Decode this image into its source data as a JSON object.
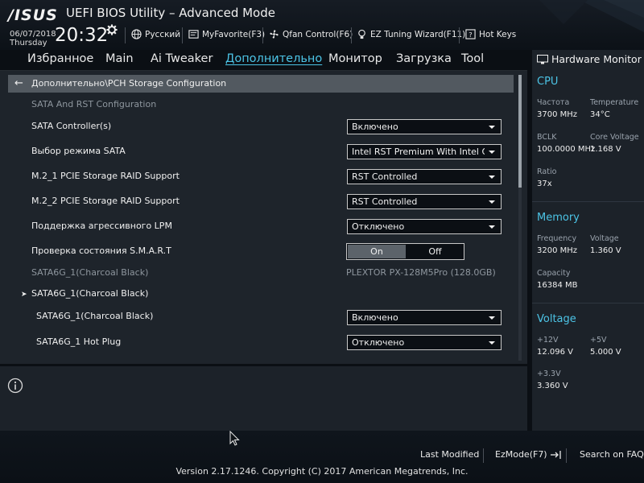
{
  "header": {
    "logo": "/ISUS",
    "title": "UEFI BIOS Utility – Advanced Mode",
    "date": "06/07/2018",
    "day": "Thursday",
    "time": "20:32",
    "buttons": [
      {
        "label": "Русский",
        "icon": "globe-icon"
      },
      {
        "label": "MyFavorite(F3)",
        "icon": "favorite-icon"
      },
      {
        "label": "Qfan Control(F6)",
        "icon": "fan-icon"
      },
      {
        "label": "EZ Tuning Wizard(F11)",
        "icon": "bulb-icon"
      },
      {
        "label": "Hot Keys",
        "icon": "hotkeys-icon"
      }
    ]
  },
  "tabs": [
    {
      "label": "Избранное",
      "active": false
    },
    {
      "label": "Main",
      "active": false
    },
    {
      "label": "Ai Tweaker",
      "active": false
    },
    {
      "label": "Дополнительно",
      "active": true
    },
    {
      "label": "Монитор",
      "active": false
    },
    {
      "label": "Загрузка",
      "active": false
    },
    {
      "label": "Tool",
      "active": false
    }
  ],
  "breadcrumb": "Дополнительно\\PCH Storage Configuration",
  "section_header": "SATA And RST Configuration",
  "rows": [
    {
      "label": "SATA Controller(s)",
      "type": "select",
      "value": "Включено"
    },
    {
      "label": "Выбор режима SATA",
      "type": "select",
      "value": "Intel RST Premium With Intel Optane"
    },
    {
      "label": "M.2_1 PCIE Storage RAID Support",
      "type": "select",
      "value": "RST Controlled"
    },
    {
      "label": "M.2_2 PCIE Storage RAID Support",
      "type": "select",
      "value": "RST Controlled"
    },
    {
      "label": "Поддержка агрессивного LPM",
      "type": "select",
      "value": "Отключено"
    },
    {
      "label": "Проверка состояния S.M.A.R.T",
      "type": "toggle",
      "on": "On",
      "off": "Off"
    },
    {
      "label": "SATA6G_1(Charcoal Black)",
      "type": "static",
      "value": "PLEXTOR PX-128M5Pro (128.0GB)"
    },
    {
      "label": "SATA6G_1(Charcoal Black)",
      "type": "submenu"
    },
    {
      "label": "SATA6G_1(Charcoal Black)",
      "type": "select",
      "value": "Включено"
    },
    {
      "label": "SATA6G_1 Hot Plug",
      "type": "select",
      "value": "Отключено"
    }
  ],
  "hardware_monitor": {
    "title": "Hardware Monitor",
    "cpu": {
      "title": "CPU",
      "freq_label": "Частота",
      "freq": "3700 MHz",
      "temp_label": "Temperature",
      "temp": "34°C",
      "bclk_label": "BCLK",
      "bclk": "100.0000 MHz",
      "vcore_label": "Core Voltage",
      "vcore": "1.168 V",
      "ratio_label": "Ratio",
      "ratio": "37x"
    },
    "memory": {
      "title": "Memory",
      "freq_label": "Frequency",
      "freq": "3200 MHz",
      "volt_label": "Voltage",
      "volt": "1.360 V",
      "cap_label": "Capacity",
      "cap": "16384 MB"
    },
    "voltage": {
      "title": "Voltage",
      "v12_label": "+12V",
      "v12": "12.096 V",
      "v5_label": "+5V",
      "v5": "5.000 V",
      "v33_label": "+3.3V",
      "v33": "3.360 V"
    }
  },
  "footer": {
    "last_modified": "Last Modified",
    "ezmode": "EzMode(F7)",
    "search": "Search on FAQ",
    "version": "Version 2.17.1246. Copyright (C) 2017 American Megatrends, Inc."
  },
  "colors": {
    "accent": "#4cc4e6",
    "panel": "#1e242b",
    "background": "#0b0f14"
  }
}
